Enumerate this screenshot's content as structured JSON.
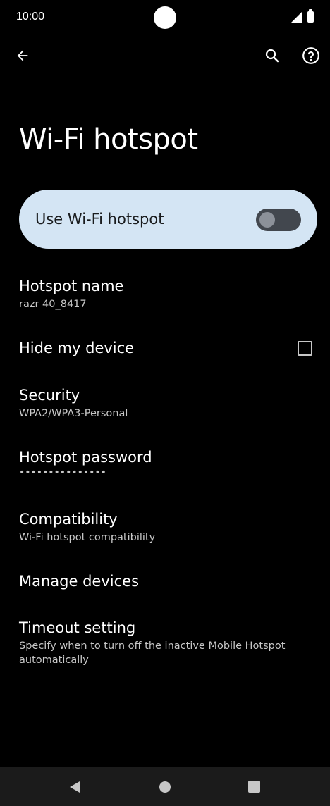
{
  "status_bar": {
    "time": "10:00"
  },
  "toolbar": {
    "back_icon": "arrow-left-icon",
    "search_icon": "search-icon",
    "help_icon": "help-circle-icon"
  },
  "page": {
    "title": "Wi-Fi hotspot"
  },
  "main_switch": {
    "label": "Use Wi-Fi hotspot",
    "state": "off",
    "card_color": "#d4e5f4"
  },
  "settings": {
    "hotspot_name": {
      "title": "Hotspot name",
      "value": "razr 40_8417"
    },
    "hide_device": {
      "title": "Hide my device",
      "checked": false
    },
    "security": {
      "title": "Security",
      "value": "WPA2/WPA3-Personal"
    },
    "hotspot_password": {
      "title": "Hotspot password",
      "value": "•••••••••••••••"
    },
    "compatibility": {
      "title": "Compatibility",
      "value": "Wi-Fi hotspot compatibility"
    },
    "manage_devices": {
      "title": "Manage devices"
    },
    "timeout": {
      "title": "Timeout setting",
      "value": "Specify when to turn off the inactive Mobile Hotspot automatically"
    }
  },
  "nav_bar": {
    "back_icon": "triangle-back-icon",
    "home_icon": "circle-home-icon",
    "recents_icon": "square-recents-icon"
  }
}
